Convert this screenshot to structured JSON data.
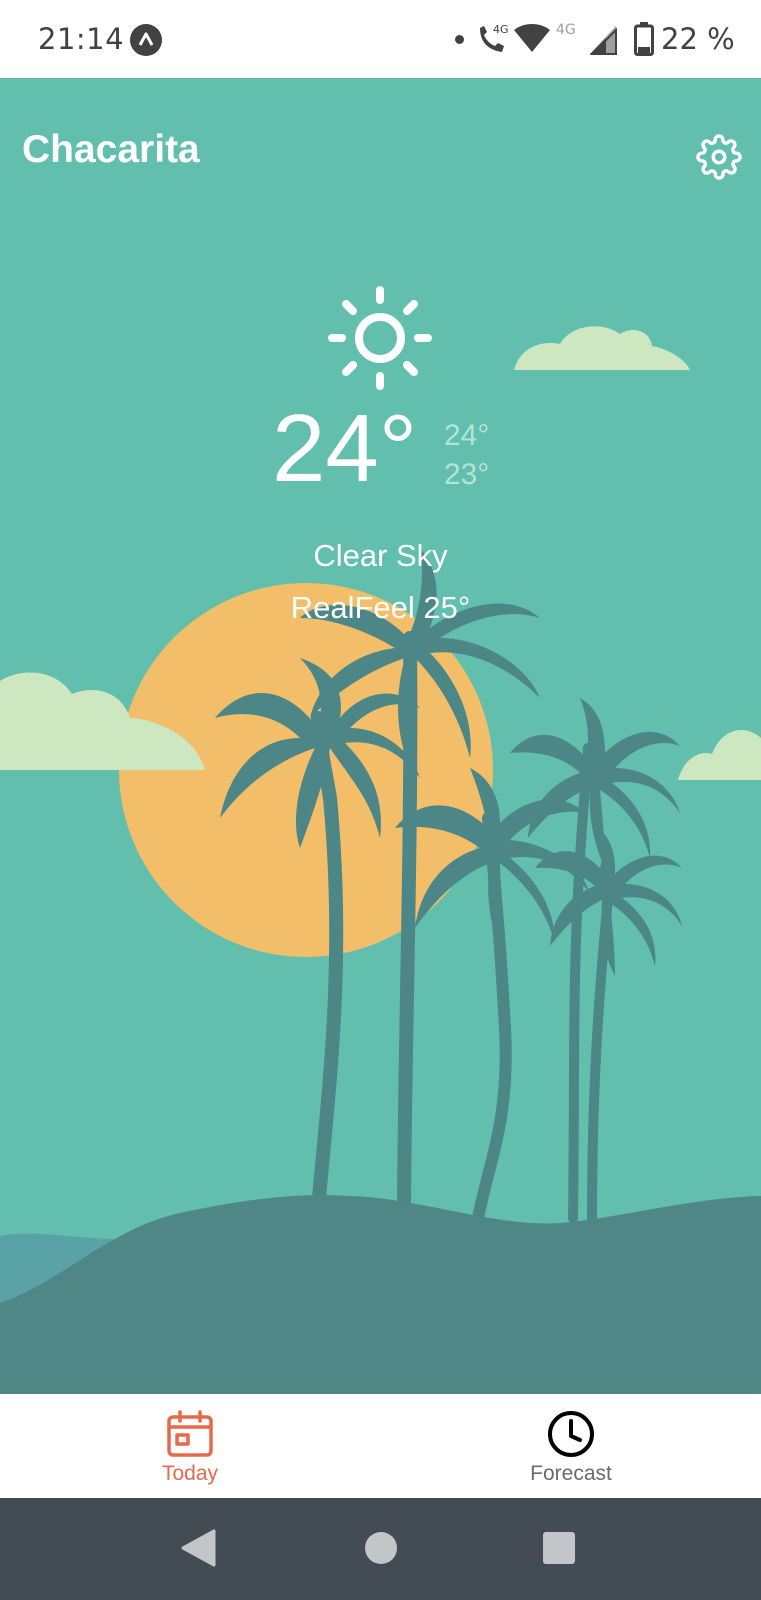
{
  "status_bar": {
    "time": "21:14",
    "network_label_1": "4G",
    "network_label_2": "4G",
    "battery": "22 %"
  },
  "header": {
    "city": "Chacarita",
    "settings_icon": "gear-icon"
  },
  "weather": {
    "icon": "sun-icon",
    "temperature": "24°",
    "high": "24°",
    "low": "23°",
    "condition": "Clear Sky",
    "realfeel": "RealFeel 25°"
  },
  "bottom_nav": {
    "items": [
      {
        "label": "Today",
        "icon": "calendar-icon",
        "active": true
      },
      {
        "label": "Forecast",
        "icon": "clock-icon",
        "active": false
      }
    ]
  },
  "colors": {
    "sky": "#62bfad",
    "sun": "#f2be69",
    "cloud": "#cde7c0",
    "palm": "#4d8687",
    "hill": "#4e8786",
    "active_accent": "#e8694a",
    "system_nav": "#434c54"
  }
}
